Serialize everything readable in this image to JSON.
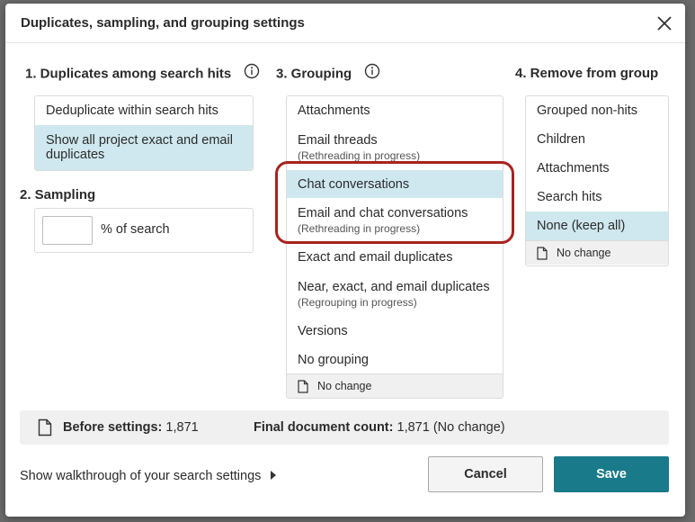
{
  "dialog": {
    "title": "Duplicates, sampling, and grouping settings"
  },
  "duplicates": {
    "title": "1. Duplicates among search hits",
    "options": [
      {
        "label": "Deduplicate within search hits",
        "selected": false
      },
      {
        "label": "Show all project exact and email duplicates",
        "selected": true
      }
    ]
  },
  "sampling": {
    "title": "2. Sampling",
    "input_value": "",
    "label": "% of search"
  },
  "grouping": {
    "title": "3. Grouping",
    "options": [
      {
        "label": "Attachments",
        "sub": ""
      },
      {
        "label": "Email threads",
        "sub": "(Rethreading in progress)"
      },
      {
        "label": "Chat conversations",
        "sub": ""
      },
      {
        "label": "Email and chat conversations",
        "sub": "(Rethreading in progress)"
      },
      {
        "label": "Exact and email duplicates",
        "sub": ""
      },
      {
        "label": "Near, exact, and email duplicates",
        "sub": "(Regrouping in progress)"
      },
      {
        "label": "Versions",
        "sub": ""
      },
      {
        "label": "No grouping",
        "sub": ""
      }
    ],
    "selected_index": 2,
    "footer": "No change"
  },
  "remove": {
    "title": "4. Remove from group",
    "options": [
      {
        "label": "Grouped non-hits"
      },
      {
        "label": "Children"
      },
      {
        "label": "Attachments"
      },
      {
        "label": "Search hits"
      },
      {
        "label": "None (keep all)"
      }
    ],
    "selected_index": 4,
    "footer": "No change"
  },
  "summary": {
    "before_label": "Before settings:",
    "before_value": "1,871",
    "final_label": "Final document count:",
    "final_value": "1,871 (No change)"
  },
  "footer": {
    "walkthrough": "Show walkthrough of your search settings",
    "cancel": "Cancel",
    "save": "Save"
  },
  "colors": {
    "selected_bg": "#cfe8ef",
    "save_bg": "#197a8a",
    "highlight": "#a8231e"
  },
  "icons": [
    "close-icon",
    "info-icon",
    "document-icon",
    "triangle-right-icon"
  ]
}
